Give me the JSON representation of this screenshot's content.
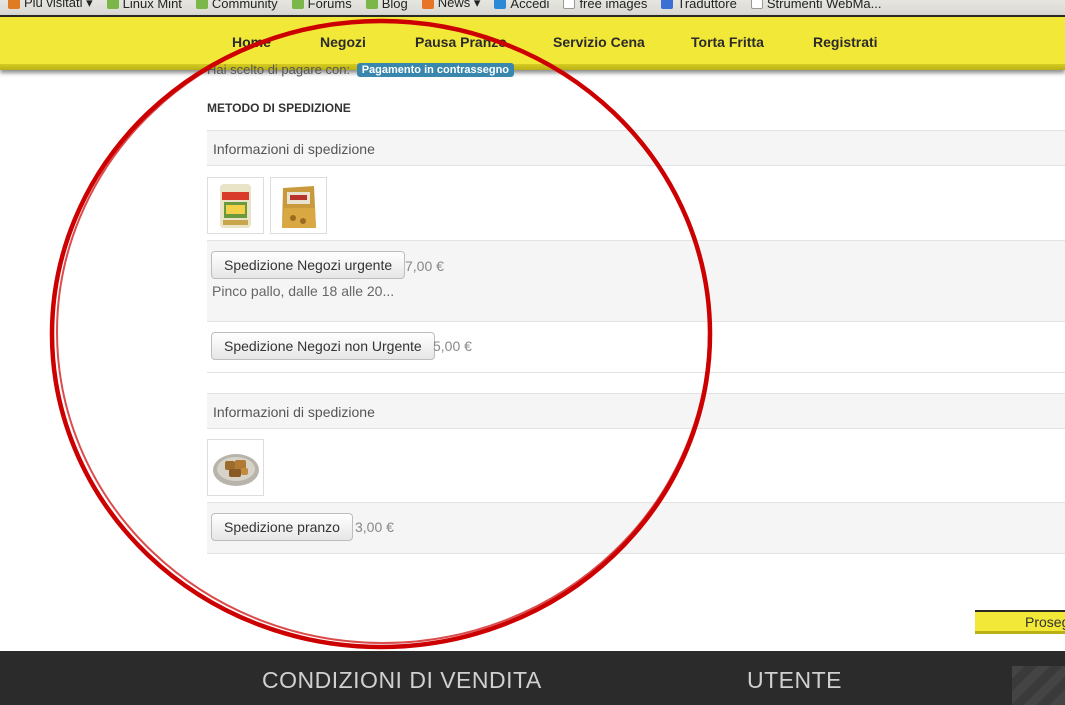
{
  "bookmarks": [
    {
      "label": "Più visitati ▾",
      "icon": "most-visited-icon",
      "color": "#e07b22"
    },
    {
      "label": "Linux Mint",
      "icon": "mint-icon",
      "color": "#7ab648"
    },
    {
      "label": "Community",
      "icon": "mint-icon",
      "color": "#7ab648"
    },
    {
      "label": "Forums",
      "icon": "mint-icon",
      "color": "#7ab648"
    },
    {
      "label": "Blog",
      "icon": "mint-icon",
      "color": "#7ab648"
    },
    {
      "label": "News ▾",
      "icon": "rss-icon",
      "color": "#e8742a"
    },
    {
      "label": "Accedi",
      "icon": "windows-icon",
      "color": "#2b8ad8"
    },
    {
      "label": "free images",
      "icon": "page-icon",
      "color": "#999999"
    },
    {
      "label": "Traduttore",
      "icon": "translate-icon",
      "color": "#3b6fd6"
    },
    {
      "label": "Strumenti WebMa...",
      "icon": "page-icon",
      "color": "#999999"
    }
  ],
  "nav": {
    "items": [
      "Home",
      "Negozi",
      "Pausa Pranzo",
      "Servizio Cena",
      "Torta Fritta",
      "Registrati"
    ]
  },
  "payment": {
    "prefix": "Hai scelto di pagare con:",
    "badge": "Pagamento in contrassegno"
  },
  "shipping": {
    "title": "METODO DI SPEDIZIONE",
    "group1": {
      "info": "Informazioni di spedizione",
      "options": [
        {
          "button": "Spedizione Negozi urgente",
          "price": "7,00 €",
          "description": "Pinco pallo, dalle 18 alle 20..."
        },
        {
          "button": "Spedizione Negozi non Urgente",
          "price": "5,00 €"
        }
      ]
    },
    "group2": {
      "info": "Informazioni di spedizione",
      "options": [
        {
          "button": "Spedizione pranzo",
          "price": "3,00 €"
        }
      ]
    }
  },
  "proceed_label": "Prosegui",
  "footer": {
    "col1": "CONDIZIONI DI VENDITA",
    "col2": "UTENTE"
  },
  "colors": {
    "nav_yellow": "#f2e838",
    "badge_blue": "#3a87ad",
    "annotation_red": "#cc0000",
    "footer_dark": "#2b2b2b"
  }
}
